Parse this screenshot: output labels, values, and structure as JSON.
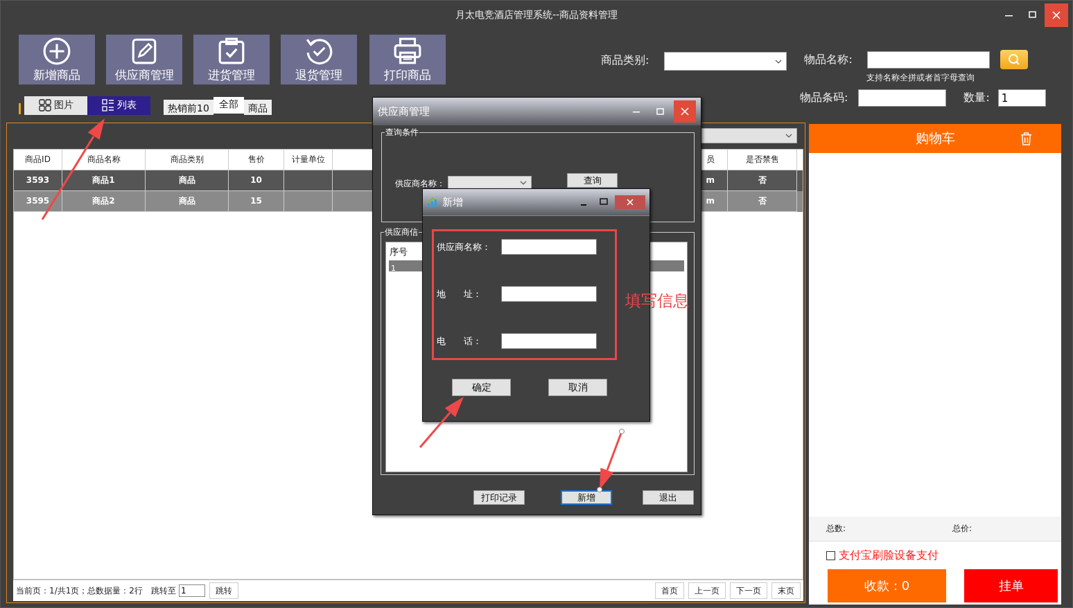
{
  "window": {
    "title": "月太电竞酒店管理系统--商品资料管理"
  },
  "toolbar": [
    {
      "label": "新增商品",
      "kind": "add"
    },
    {
      "label": "供应商管理",
      "kind": "edit"
    },
    {
      "label": "进货管理",
      "kind": "clipboard"
    },
    {
      "label": "退货管理",
      "kind": "undo"
    },
    {
      "label": "打印商品",
      "kind": "print"
    }
  ],
  "view_toggle": [
    {
      "label": "图片",
      "kind": "grid",
      "selected": false
    },
    {
      "label": "列表",
      "kind": "list",
      "selected": true
    }
  ],
  "filters": [
    {
      "label": "热销前10",
      "selected": false
    },
    {
      "label": "全部",
      "selected": true
    },
    {
      "label": "商品",
      "selected": false
    }
  ],
  "search": {
    "category_label": "商品类别:",
    "name_label": "物品名称:",
    "hint": "支持名称全拼或者首字母查询",
    "barcode_label": "物品条码:",
    "quantity_label": "数量:",
    "quantity": "1"
  },
  "table": {
    "columns": [
      "商品ID",
      "商品名称",
      "商品类别",
      "售价",
      "计量单位",
      "员",
      "是否禁售"
    ],
    "rows": [
      {
        "id": "3593",
        "name": "商品1",
        "category": "商品",
        "price": "10",
        "column_6": "m",
        "banned": "否",
        "selected": true
      },
      {
        "id": "3595",
        "name": "商品2",
        "category": "商品",
        "price": "15",
        "column_6": "m",
        "banned": "否",
        "selected": false
      }
    ]
  },
  "pager": {
    "info": "当前页：1/共1页；总数据量：2行",
    "jump_label": "跳转至",
    "page": "1",
    "jump": "跳转",
    "buttons": [
      "首页",
      "上一页",
      "下一页",
      "末页"
    ]
  },
  "cart": {
    "title": "购物车",
    "count_label": "总数:",
    "total_label": "总价:",
    "alipay": {
      "label": "支付宝刷脸设备支付",
      "checked": false
    },
    "pay": "收款：0",
    "hold": "挂单"
  },
  "supplier_dialog": {
    "title": "供应商管理",
    "query_group": "查询条件",
    "name_label": "供应商名称：",
    "query": "查询",
    "info_group": "供应商信",
    "table": {
      "columns": [
        "序号"
      ],
      "rows": [
        {
          "no": "1",
          "selected": true
        }
      ]
    },
    "buttons": [
      {
        "label": "打印记录",
        "focused": false
      },
      {
        "label": "新增",
        "focused": true
      },
      {
        "label": "退出",
        "focused": false
      }
    ]
  },
  "add_dialog": {
    "title": "新增",
    "fields": [
      {
        "label": "供应商名称："
      },
      {
        "label": "地　　址："
      },
      {
        "label": "电　　话："
      }
    ],
    "ok": "确定",
    "cancel": "取消"
  },
  "annotation": {
    "text": "填写信息"
  }
}
